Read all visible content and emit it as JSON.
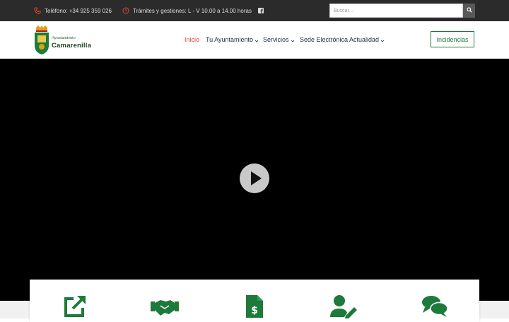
{
  "topbar": {
    "phone": "Teléfono: +34 925 359 026",
    "hours": "Trámites y gestiones: L - V 10.00 a 14.00 horas",
    "facebook_icon": "facebook-icon",
    "search_placeholder": "Buscar..."
  },
  "logo": {
    "line1": "Ayuntamiento",
    "line2": "Camarenilla"
  },
  "nav": {
    "items": [
      {
        "label": "Inicio",
        "active": true
      },
      {
        "label": "Tu Ayuntamiento",
        "dropdown": true
      },
      {
        "label": "Servicios",
        "dropdown": true
      },
      {
        "label": "Sede Electrónica"
      },
      {
        "label": "Actualidad",
        "dropdown": true
      }
    ],
    "cta": "Incidencias"
  },
  "video": {
    "play_icon": "play-icon"
  },
  "services": {
    "icons": [
      "external-link-icon",
      "handshake-icon",
      "invoice-icon",
      "user-edit-icon",
      "comments-icon"
    ]
  },
  "colors": {
    "topbar": "#2b2b2b",
    "accent_red": "#e04b2e",
    "brand_green": "#1d7a3a",
    "nav_text": "#1a2c4a"
  }
}
